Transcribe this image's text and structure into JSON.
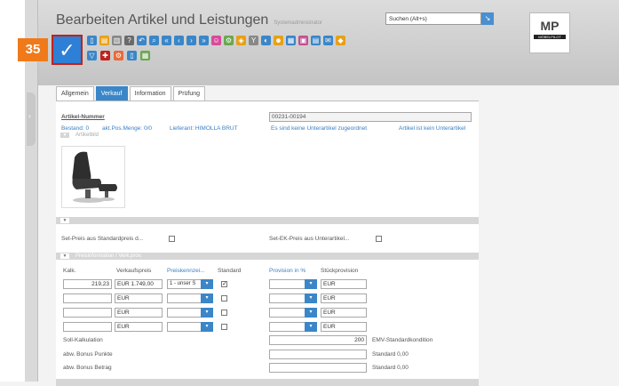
{
  "step_number": "35",
  "header": {
    "title": "Bearbeiten Artikel und Leistungen",
    "user": "Systemadministrator",
    "search_placeholder": "Suchen (Alt+s)",
    "logo_text": "MP",
    "logo_sub": "MÖBELPILOT"
  },
  "toolbar": {
    "save_icon": "checkmark-icon",
    "icons_row1": [
      "new-document-icon",
      "note-icon",
      "delete-icon",
      "help-icon",
      "back-arrow-icon",
      "search-icon",
      "first-page-icon",
      "previous-page-icon",
      "next-page-icon",
      "last-page-icon",
      "users-icon",
      "settings-icon",
      "bucket-icon",
      "tools-icon",
      "globe-icon",
      "group-icon",
      "chart-icon",
      "calendar-icon",
      "report-icon",
      "mail-icon",
      "ribbon-icon"
    ],
    "icons_row2": [
      "filter-icon",
      "flag-icon",
      "badge-icon",
      "document-icon",
      "image-icon"
    ]
  },
  "tabs": [
    "Allgemein",
    "Verkauf",
    "Information",
    "Prüfung"
  ],
  "active_tab": "Verkauf",
  "article": {
    "number_label": "Artikel-Nummer",
    "number_value": "00231-00194",
    "info": {
      "stock": "Bestand: 0",
      "pos_qty": "akt.Pos.Menge: 0/0",
      "supplier": "Lieferant: HIMOLLA BRUT",
      "no_sub": "Es sind keine Unterartikel zugeordnet",
      "not_sub": "Artikel ist kein Unterartikel"
    },
    "image_section": "Artikelbild"
  },
  "set_price": {
    "std_label": "Set-Preis aus Standardpreis d...",
    "sub_label": "Set-EK-Preis aus Unterartikel..."
  },
  "price_section": {
    "title": "Preisinformation / Verk.prov.",
    "headers": {
      "kalk": "Kalk.",
      "vk": "Verkaufspreis",
      "kennz": "Preiskennzei...",
      "std": "Standard",
      "prov": "Provision in %",
      "stueck": "Stückprovision"
    },
    "rows": [
      {
        "kalk": "219,23",
        "vk": "EUR 1.749,00",
        "kennz": "1 - unser S",
        "std_checked": true,
        "prov": "",
        "stueck": "EUR"
      },
      {
        "kalk": "",
        "vk": "EUR",
        "kennz": "",
        "std_checked": false,
        "prov": "",
        "stueck": "EUR"
      },
      {
        "kalk": "",
        "vk": "EUR",
        "kennz": "",
        "std_checked": false,
        "prov": "",
        "stueck": "EUR"
      },
      {
        "kalk": "",
        "vk": "EUR",
        "kennz": "",
        "std_checked": false,
        "prov": "",
        "stueck": "EUR"
      }
    ],
    "soll_label": "Soll-Kalkulation",
    "soll_value": "200",
    "soll_note": "EMV-Standardkondition",
    "bonus_points_label": "abw. Bonus Punkte",
    "bonus_points_note": "Standard 0,00",
    "bonus_amount_label": "abw. Bonus Betrag",
    "bonus_amount_note": "Standard 0,00"
  },
  "colors": {
    "accent": "#3a86c8",
    "step": "#f07a1a",
    "highlight": "#c0221b"
  }
}
